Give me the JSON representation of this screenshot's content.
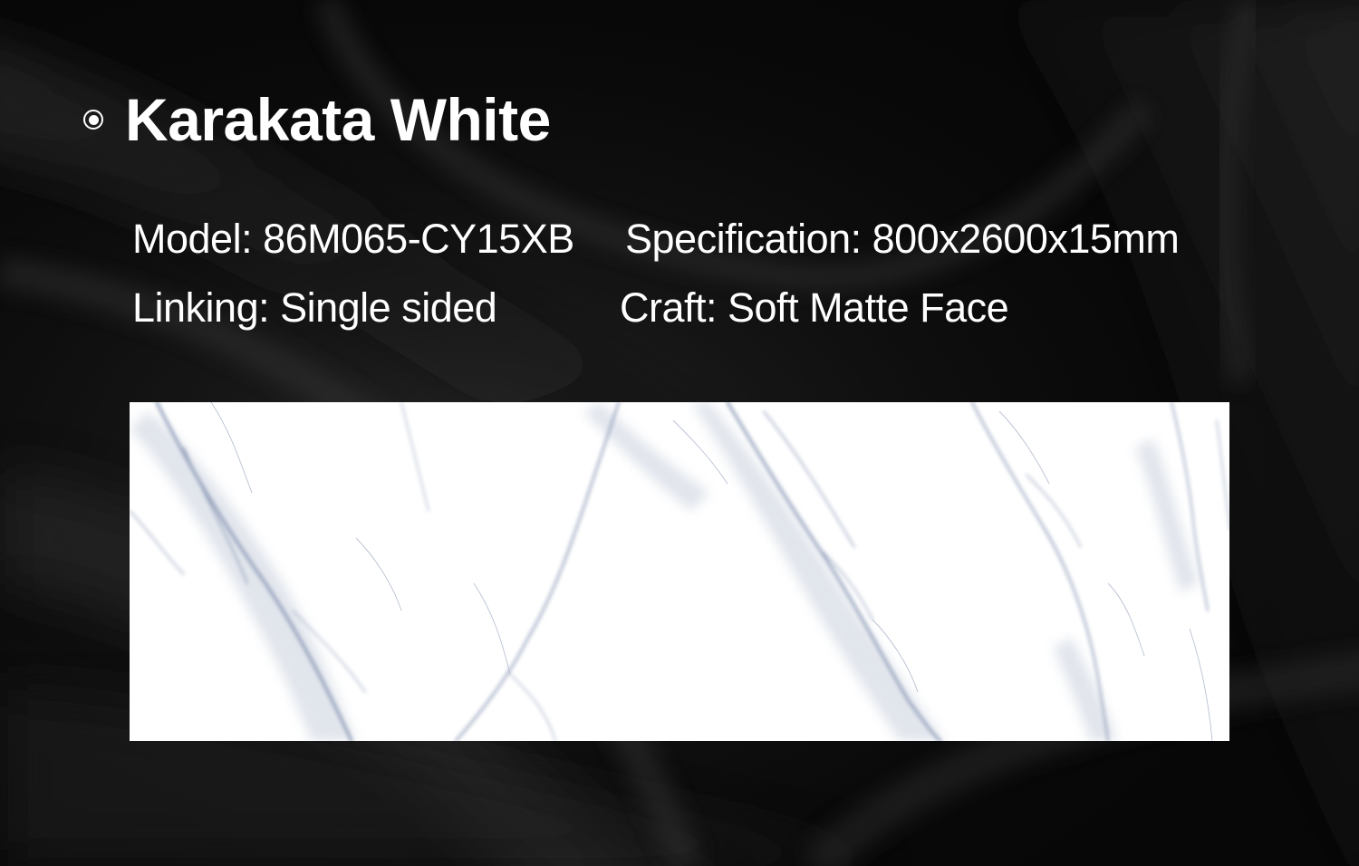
{
  "product": {
    "name": "Karakata White"
  },
  "specs": {
    "model": "Model: 86M065-CY15XB",
    "specification": "Specification: 800x2600x15mm",
    "linking": "Linking: Single sided",
    "craft": "Craft: Soft Matte Face"
  },
  "colors": {
    "background": "#060606",
    "text": "#ffffff",
    "marble_base": "#ffffff",
    "marble_vein": "#8c9bb8"
  },
  "icons": {
    "bullet": "radio-bullet-icon"
  }
}
